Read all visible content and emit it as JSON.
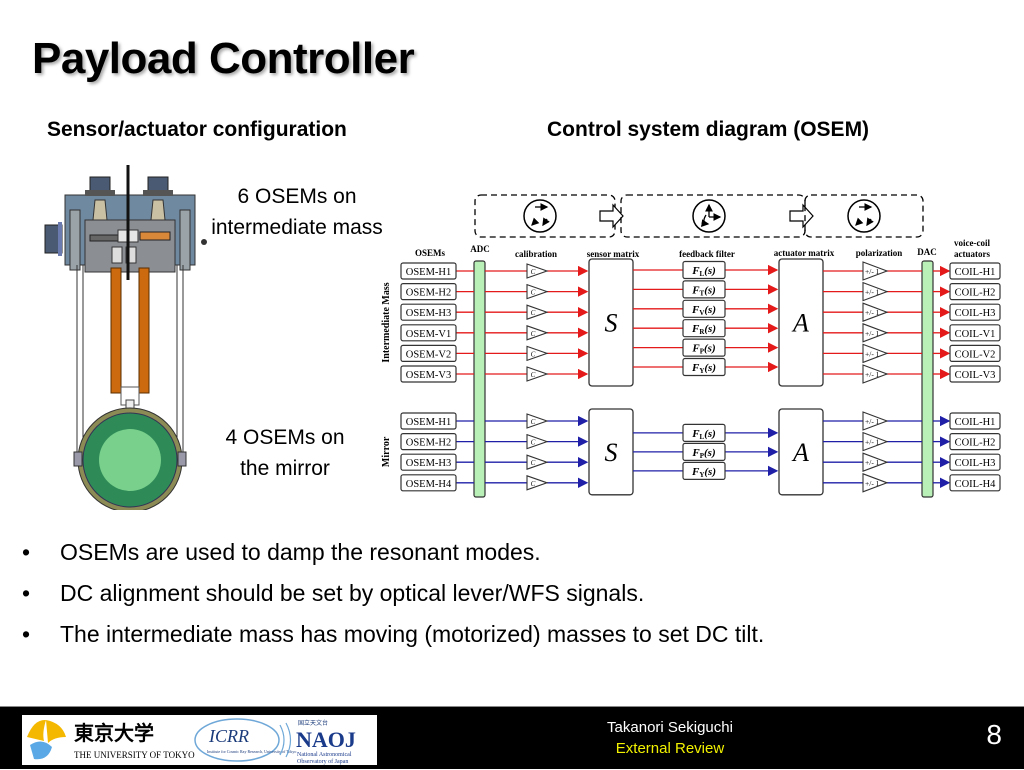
{
  "slide": {
    "title": "Payload Controller",
    "left_heading": "Sensor/actuator configuration",
    "right_heading": "Control system diagram (OSEM)",
    "caption_top_line1": "6 OSEMs on",
    "caption_top_line2": "intermediate mass",
    "caption_bottom_line1": "4 OSEMs on",
    "caption_bottom_line2": "the mirror",
    "bullet_glyph": "•",
    "bullets": [
      "OSEMs are used to damp the resonant modes.",
      "DC alignment should be set by optical lever/WFS signals.",
      "The intermediate mass has moving (motorized) masses to set DC tilt."
    ]
  },
  "diagram": {
    "column_labels": {
      "osems": "OSEMs",
      "adc": "ADC",
      "calibration": "calibration",
      "sensor_matrix": "sensor matrix",
      "feedback_filter": "feedback filter",
      "actuator_matrix": "actuator matrix",
      "polarization": "polarization",
      "dac": "DAC",
      "actuators_line1": "voice-coil",
      "actuators_line2": "actuators"
    },
    "stage_icons": [
      "rotation-cycle-icon",
      "clock-rotation-icon",
      "rotation-cycle-icon"
    ],
    "calibration_symbol": "C",
    "sensor_matrix_symbol": "S",
    "actuator_matrix_symbol": "A",
    "polarization_symbol": "+/- 1",
    "colors": {
      "im_signal": "#e41a1a",
      "mirror_signal": "#1f1fa8",
      "converter_fill": "#b8f0b8"
    },
    "groups": [
      {
        "label": "Intermediate Mass",
        "osems": [
          "OSEM-H1",
          "OSEM-H2",
          "OSEM-H3",
          "OSEM-V1",
          "OSEM-V2",
          "OSEM-V3"
        ],
        "filters": [
          {
            "base": "F",
            "sub": "L",
            "arg": "(s)"
          },
          {
            "base": "F",
            "sub": "T",
            "arg": "(s)"
          },
          {
            "base": "F",
            "sub": "V",
            "arg": "(s)"
          },
          {
            "base": "F",
            "sub": "R",
            "arg": "(s)"
          },
          {
            "base": "F",
            "sub": "P",
            "arg": "(s)"
          },
          {
            "base": "F",
            "sub": "Y",
            "arg": "(s)"
          }
        ],
        "coils": [
          "COIL-H1",
          "COIL-H2",
          "COIL-H3",
          "COIL-V1",
          "COIL-V2",
          "COIL-V3"
        ]
      },
      {
        "label": "Mirror",
        "osems": [
          "OSEM-H1",
          "OSEM-H2",
          "OSEM-H3",
          "OSEM-H4"
        ],
        "filters": [
          {
            "base": "F",
            "sub": "L",
            "arg": "(s)"
          },
          {
            "base": "F",
            "sub": "P",
            "arg": "(s)"
          },
          {
            "base": "F",
            "sub": "Y",
            "arg": "(s)"
          }
        ],
        "coils": [
          "COIL-H1",
          "COIL-H2",
          "COIL-H3",
          "COIL-H4"
        ]
      }
    ]
  },
  "footer": {
    "logos": {
      "utokyo_kanji": "東京大学",
      "utokyo_en": "THE UNIVERSITY OF TOKYO",
      "icrr": "ICRR",
      "icrr_sub": "Institute for Cosmic Ray Research, University of Tokyo",
      "naoj_jp": "国立天文台",
      "naoj": "NAOJ",
      "naoj_sub1": "National Astronomical",
      "naoj_sub2": "Observatory of Japan"
    },
    "author": "Takanori Sekiguchi",
    "event": "External Review",
    "page_number": "8"
  }
}
